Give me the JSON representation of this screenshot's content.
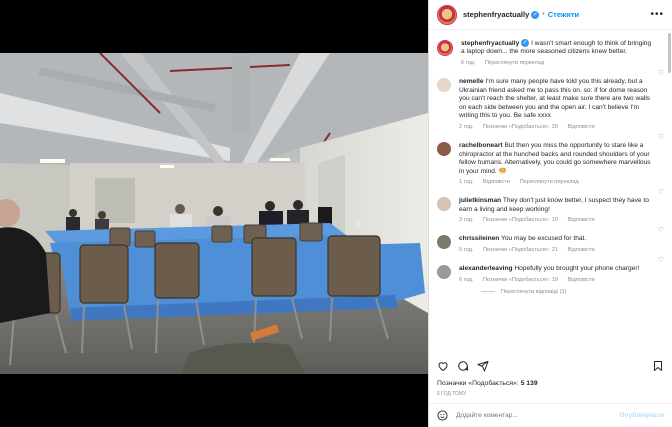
{
  "post": {
    "username": "stephenfryactually",
    "follow_label": "Стежити",
    "caption_username": "stephenfryactually",
    "caption_text": "I wasn't smart enough to think of bringing a laptop down... the more seasoned citizens knew better.",
    "caption_age": "6 год.",
    "caption_translate": "Переглянути переклад",
    "likes_prefix": "Позначки «Подобається»:",
    "likes_count": "5 139",
    "timestamp": "6 ГОД ТОМУ",
    "add_comment_placeholder": "Додайте коментар...",
    "post_button": "Опублікувати"
  },
  "comments": [
    {
      "username": "nemelle",
      "text": "I'm sure many people have told you this already, but a Ukrainian friend asked me to pass this on. so: if for dome reason you can't reach the shelter, at least make sure there are two walls on each side between you and the open air. I can't believe I'm writing this to you. Be safe xxxx",
      "age": "2 год.",
      "likes": "Позначки «Подобається»: 20",
      "reply": "Відповісти",
      "translate": "",
      "avatar_color": "#e8d6c8"
    },
    {
      "username": "rachelboneart",
      "text": "But then you miss the opportunity to stare like a chiropractor at the hunched backs and rounded shoulders of your fellow humans. Alternatively, you could go somewhere marvellous in your mind. 🥯",
      "age": "1 год.",
      "likes": "",
      "reply": "Відповісти",
      "translate": "Переглянути переклад",
      "avatar_color": "#8a5a4a"
    },
    {
      "username": "julietkinsman",
      "text": "They don't just know better, I suspect they have to earn a living and keep working!",
      "age": "3 год.",
      "likes": "Позначки «Подобається»: 10",
      "reply": "Відповісти",
      "translate": "",
      "avatar_color": "#d9c2b0"
    },
    {
      "username": "chrissileinen",
      "text": "You may be excused for that.",
      "age": "5 год.",
      "likes": "Позначки «Подобається»: 21",
      "reply": "Відповісти",
      "translate": "",
      "avatar_color": "#7a7a6a"
    },
    {
      "username": "alexanderleaving",
      "text": "Hopefully you brought your phone charger!",
      "age": "6 год.",
      "likes": "Позначки «Подобається»: 19",
      "reply": "Відповісти",
      "translate": "",
      "avatar_color": "#9a9a9a",
      "view_replies": "Переглянути відповіді (1)"
    }
  ],
  "icons": [
    "heart-icon",
    "comment-icon",
    "share-icon",
    "bookmark-icon",
    "emoji-icon",
    "more-icon",
    "verified-icon"
  ],
  "colors": {
    "accent": "#0095f6",
    "verified": "#3897f0",
    "tablecloth": "#4f8fd8"
  }
}
